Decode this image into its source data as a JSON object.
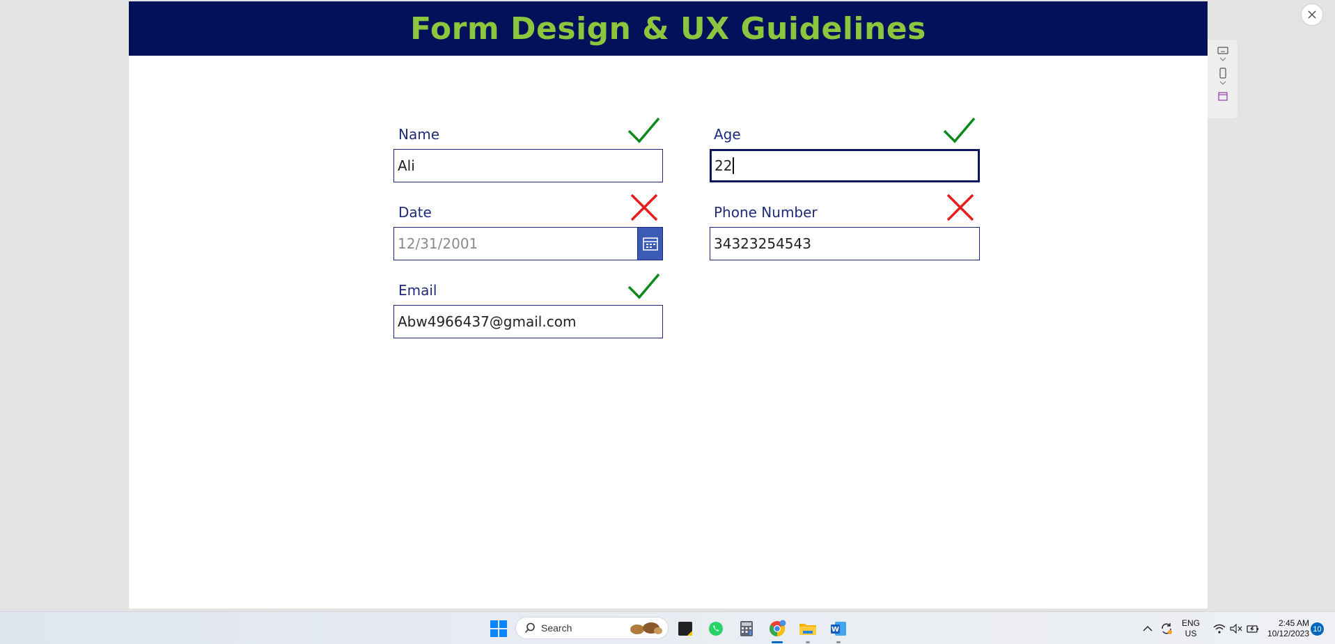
{
  "app": {
    "title": "Form Design & UX Guidelines",
    "colors": {
      "header_bg": "#021159",
      "title": "#8cc63f",
      "label": "#1f2a7a",
      "valid": "#0a8a1a",
      "invalid": "#e81b1b"
    }
  },
  "form": {
    "name": {
      "label": "Name",
      "value": "Ali",
      "status": "valid"
    },
    "age": {
      "label": "Age",
      "value": "22",
      "status": "valid"
    },
    "date": {
      "label": "Date",
      "placeholder": "12/31/2001",
      "status": "invalid",
      "icon": "calendar-icon"
    },
    "phone": {
      "label": "Phone Number",
      "value": "34323254543",
      "status": "invalid"
    },
    "email": {
      "label": "Email",
      "value": "Abw4966437@gmail.com",
      "status": "valid"
    }
  },
  "taskbar": {
    "search_label": "Search",
    "lang_line1": "ENG",
    "lang_line2": "US",
    "time": "2:45 AM",
    "date": "10/12/2023",
    "notification_count": "10",
    "pinned_icons": [
      "windows-start-icon",
      "sticky-notes-icon",
      "whatsapp-icon",
      "calculator-icon",
      "chrome-icon",
      "file-explorer-icon",
      "word-icon"
    ]
  }
}
